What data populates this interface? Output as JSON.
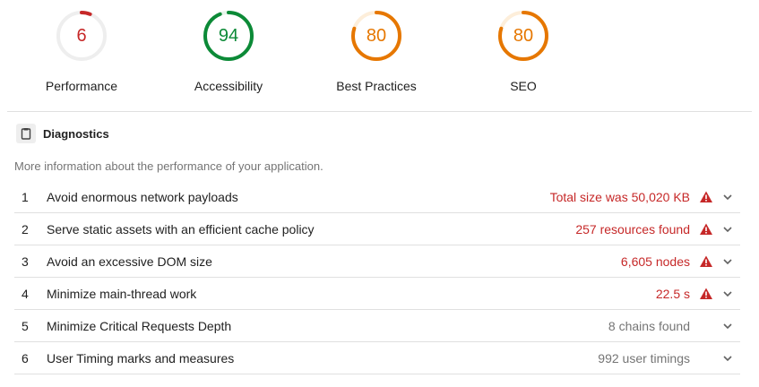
{
  "colors": {
    "fail": "#c62828",
    "pass": "#0c8a37",
    "average": "#e67700",
    "track_fail": "#eeeeee",
    "track_pass": "#e6f4ea",
    "track_average": "#fdeeda"
  },
  "gauges": [
    {
      "score": "6",
      "label": "Performance",
      "status": "fail",
      "fraction": 0.06
    },
    {
      "score": "94",
      "label": "Accessibility",
      "status": "pass",
      "fraction": 0.94
    },
    {
      "score": "80",
      "label": "Best Practices",
      "status": "average",
      "fraction": 0.8
    },
    {
      "score": "80",
      "label": "SEO",
      "status": "average",
      "fraction": 0.8
    }
  ],
  "section": {
    "icon": "clipboard-icon",
    "title": "Diagnostics",
    "description": "More information about the performance of your application."
  },
  "audits": [
    {
      "index": "1",
      "title": "Avoid enormous network payloads",
      "value": "Total size was 50,020 KB",
      "warning": true
    },
    {
      "index": "2",
      "title": "Serve static assets with an efficient cache policy",
      "value": "257 resources found",
      "warning": true
    },
    {
      "index": "3",
      "title": "Avoid an excessive DOM size",
      "value": "6,605 nodes",
      "warning": true
    },
    {
      "index": "4",
      "title": "Minimize main-thread work",
      "value": "22.5 s",
      "warning": true
    },
    {
      "index": "5",
      "title": "Minimize Critical Requests Depth",
      "value": "8 chains found",
      "warning": false
    },
    {
      "index": "6",
      "title": "User Timing marks and measures",
      "value": "992 user timings",
      "warning": false
    }
  ]
}
